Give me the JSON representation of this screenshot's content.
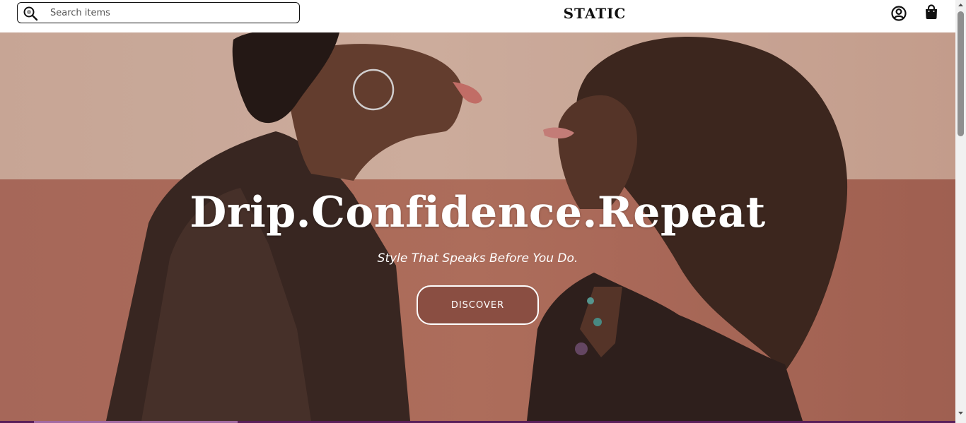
{
  "header": {
    "search": {
      "placeholder": "Search items",
      "value": "",
      "icon": "search-icon"
    },
    "brand": "STATIC",
    "account_icon": "user-circle-icon",
    "cart_icon": "shopping-bag-icon"
  },
  "hero": {
    "title": "Drip.Confidence.Repeat",
    "subtitle": "Style That Speaks Before You Do.",
    "cta_label": "DISCOVER"
  },
  "colors": {
    "brand_text": "#111111",
    "cta_bg": "#8a4e42",
    "cta_border": "#ffffff",
    "wall_upper": "#ddbaa8",
    "wall_lower": "#b87463",
    "bottom_bar": "#5a1f5a"
  }
}
